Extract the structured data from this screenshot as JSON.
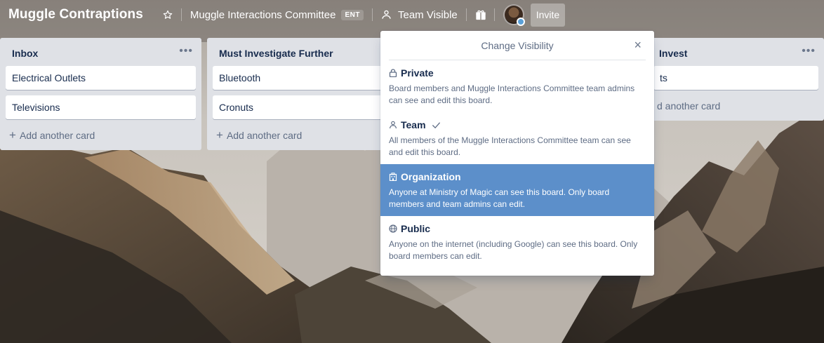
{
  "header": {
    "board_title": "Muggle Contraptions",
    "team_name": "Muggle Interactions Committee",
    "team_badge": "ENT",
    "visibility_label": "Team Visible",
    "invite_label": "Invite",
    "icons": [
      "star-icon",
      "team-icon",
      "gift-icon",
      "avatar"
    ]
  },
  "lists": [
    {
      "title": "Inbox",
      "menu": "•••",
      "cards": [
        "Electrical Outlets",
        "Televisions"
      ],
      "add_card": "Add another card"
    },
    {
      "title": "Must Investigate Further",
      "cards": [
        "Bluetooth",
        "Cronuts"
      ],
      "add_card": "Add another card"
    },
    {
      "title": "Invest",
      "menu": "•••",
      "cards": [
        "ts"
      ],
      "add_card": "d another card"
    }
  ],
  "popover": {
    "title": "Change Visibility",
    "close": "×",
    "options": [
      {
        "label": "Private",
        "icon": "lock-icon",
        "description": "Board members and Muggle Interactions Committee team admins can see and edit this board.",
        "selected": false,
        "highlighted": false
      },
      {
        "label": "Team",
        "icon": "team-icon",
        "description": "All members of the Muggle Interactions Committee team can see and edit this board.",
        "selected": true,
        "highlighted": false
      },
      {
        "label": "Organization",
        "icon": "organization-icon",
        "description": "Anyone at Ministry of Magic can see this board. Only board members and team admins can edit.",
        "selected": false,
        "highlighted": true
      },
      {
        "label": "Public",
        "icon": "globe-icon",
        "description": "Anyone on the internet (including Google) can see this board. Only board members can edit.",
        "selected": false,
        "highlighted": false
      }
    ]
  },
  "colors": {
    "highlight": "#5c8fca",
    "list_bg": "#dfe1e6",
    "text_dark": "#172b4d",
    "text_muted": "#5e6c84"
  }
}
